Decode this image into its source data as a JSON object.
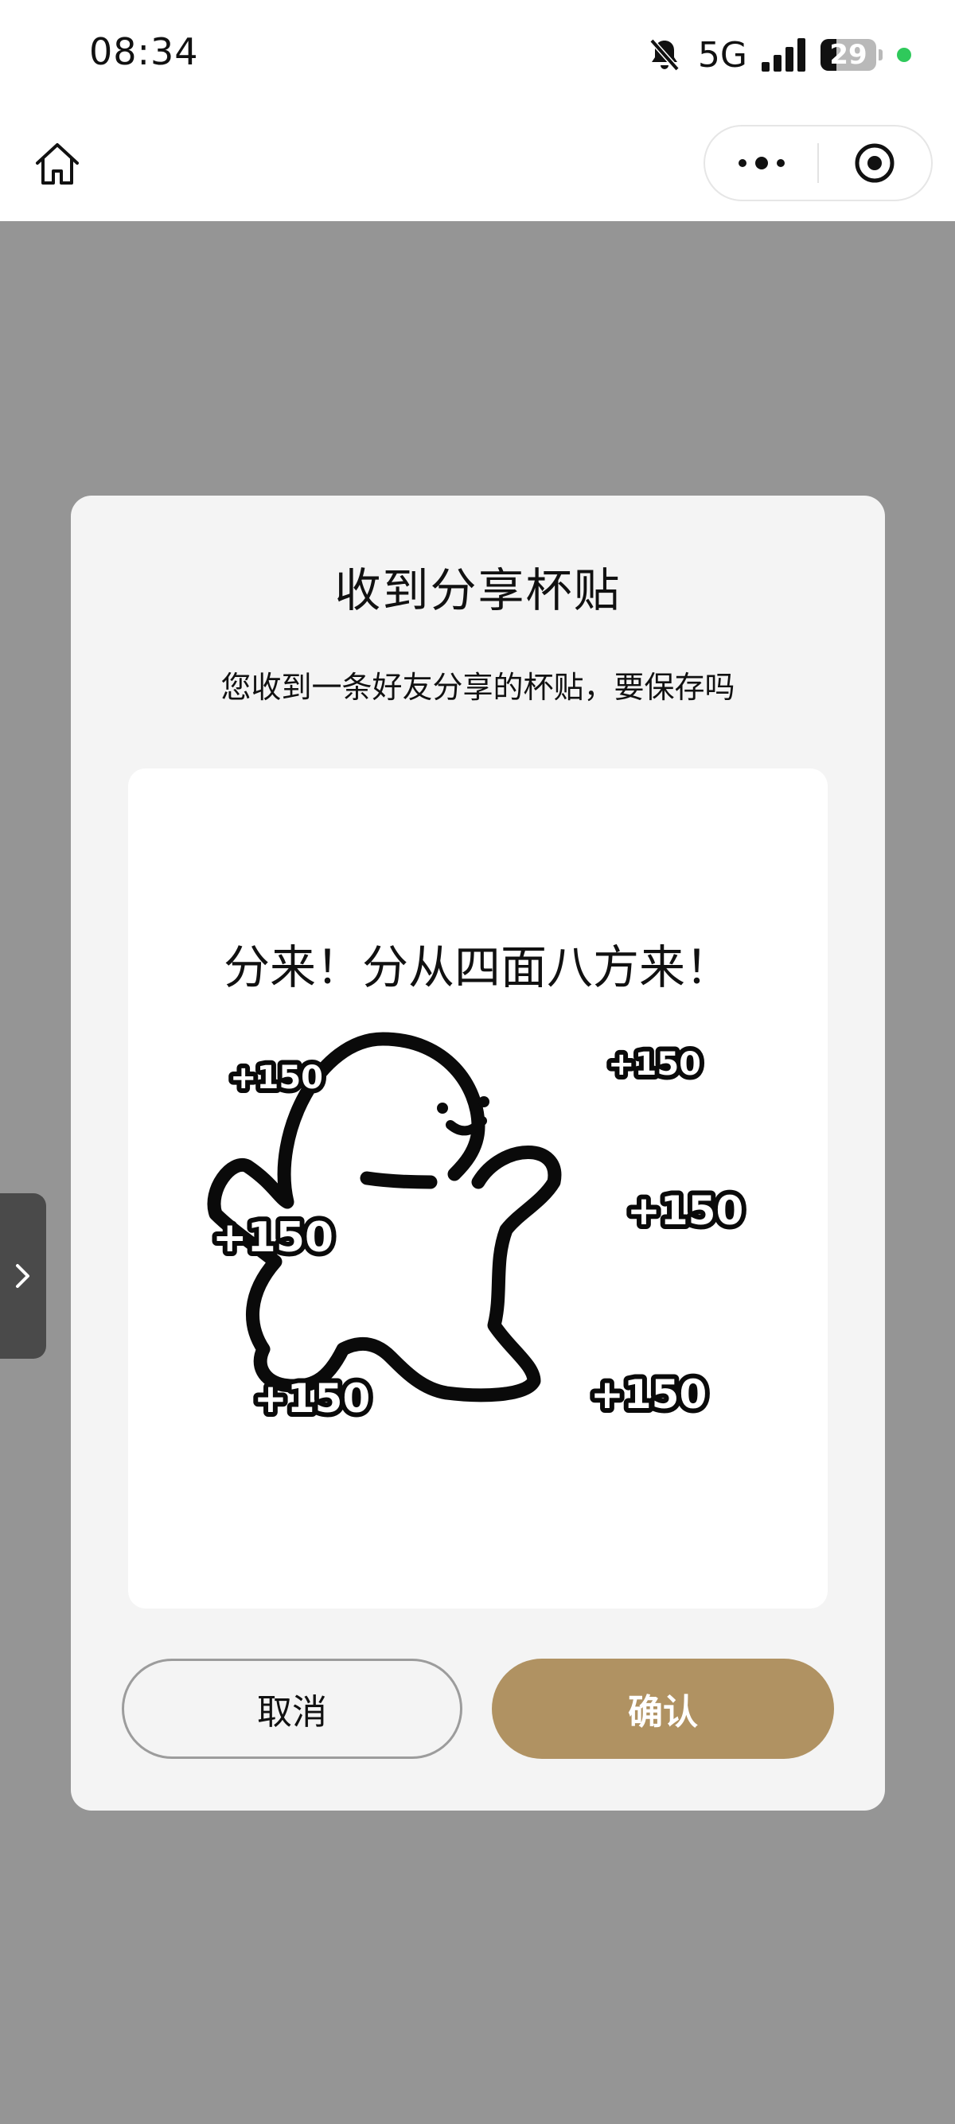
{
  "status_bar": {
    "time": "08:34",
    "network": "5G",
    "battery_level": "29",
    "battery_fraction": 0.29
  },
  "nav": {
    "home_icon": "home-icon",
    "more_icon": "more-dots-icon",
    "target_icon": "target-icon"
  },
  "dialog": {
    "title": "收到分享杯贴",
    "subtitle": "您收到一条好友分享的杯贴，要保存吗",
    "sticker": {
      "caption": "分来！分从四面八方来！",
      "badges": [
        "+150",
        "+150",
        "+150",
        "+150",
        "+150",
        "+150"
      ]
    },
    "cancel_label": "取消",
    "confirm_label": "确认"
  },
  "colors": {
    "overlay": "#959595",
    "dialog_bg": "#f4f4f4",
    "confirm_bg": "#b09262",
    "status_dot": "#2fc95b"
  }
}
